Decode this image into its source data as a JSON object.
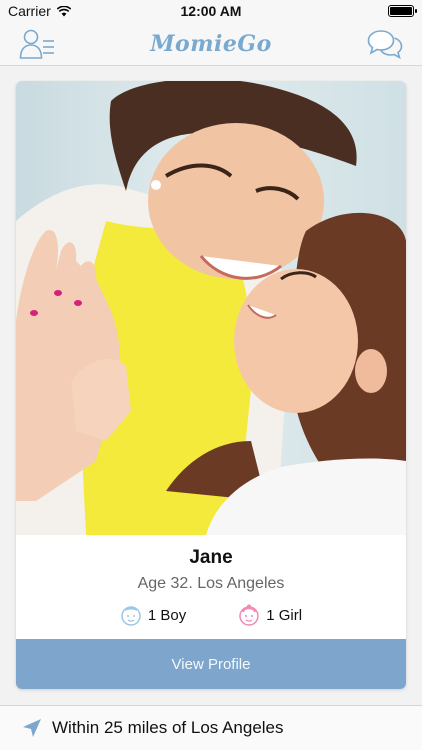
{
  "status_bar": {
    "carrier": "Carrier",
    "time": "12:00 AM",
    "battery_level": 1.0
  },
  "nav": {
    "logo": "MomieGo",
    "left_icon": "profile-menu-icon",
    "right_icon": "chat-bubbles-icon"
  },
  "profile": {
    "name": "Jane",
    "meta": "Age 32. Los Angeles",
    "boys": "1 Boy",
    "girls": "1 Girl",
    "view_label": "View Profile"
  },
  "location": {
    "text": "Within 25 miles of Los Angeles",
    "icon": "location-arrow-icon"
  },
  "colors": {
    "accent": "#7ea6cc",
    "boy": "#9cc6e6",
    "girl": "#f08ab6"
  }
}
